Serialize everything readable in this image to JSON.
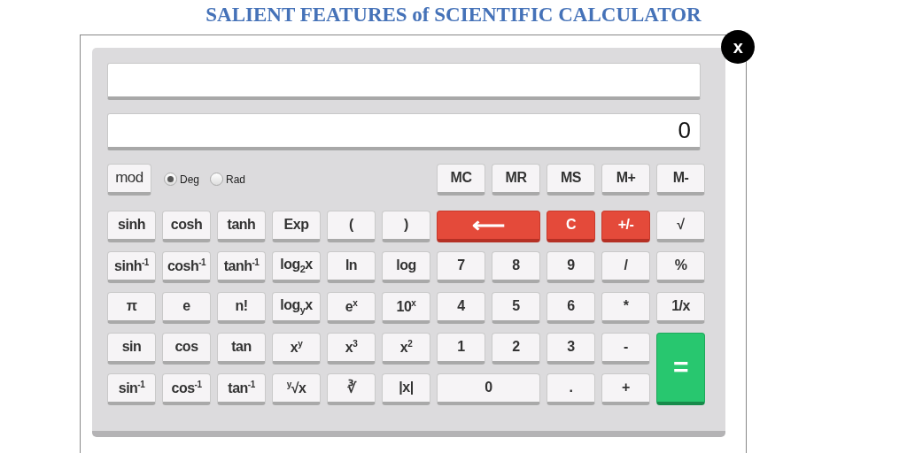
{
  "page_title": "SALIENT FEATURES of SCIENTIFIC CALCULATOR",
  "close_button": "x",
  "displays": [
    {
      "kind": "expression"
    },
    {
      "kind": "result",
      "value": "0"
    }
  ],
  "mode_button": "mod",
  "angle_units": [
    {
      "label": "Deg",
      "selected": true
    },
    {
      "label": "Rad",
      "selected": false
    }
  ],
  "memory_keys": [
    "MC",
    "MR",
    "MS",
    "M+",
    "M-"
  ],
  "keys": [
    {
      "label": "sinh",
      "kind": "plain"
    },
    {
      "label": "cosh",
      "kind": "plain"
    },
    {
      "label": "tanh",
      "kind": "plain"
    },
    {
      "label": "Exp",
      "kind": "plain"
    },
    {
      "label": "(",
      "kind": "plain"
    },
    {
      "label": ")",
      "kind": "plain"
    },
    {
      "label": "⟵",
      "kind": "red-wide"
    },
    {
      "label": "C",
      "kind": "red"
    },
    {
      "label": "+/-",
      "kind": "red"
    },
    {
      "label": "√",
      "kind": "plain"
    },
    {
      "label": "sinh$^{-1}$",
      "kind": "plain"
    },
    {
      "label": "cosh$^{-1}$",
      "kind": "plain"
    },
    {
      "label": "tanh$^{-1}$",
      "kind": "plain"
    },
    {
      "label": "log$_{2}$x",
      "kind": "plain"
    },
    {
      "label": "ln",
      "kind": "plain"
    },
    {
      "label": "log",
      "kind": "plain"
    },
    {
      "label": "7",
      "kind": "plain"
    },
    {
      "label": "8",
      "kind": "plain"
    },
    {
      "label": "9",
      "kind": "plain"
    },
    {
      "label": "/",
      "kind": "plain"
    },
    {
      "label": "%",
      "kind": "plain"
    },
    {
      "label": "π",
      "kind": "plain"
    },
    {
      "label": "e",
      "kind": "plain"
    },
    {
      "label": "n!",
      "kind": "plain"
    },
    {
      "label": "log$_{y}$x",
      "kind": "plain"
    },
    {
      "label": "e$^{x}$",
      "kind": "plain"
    },
    {
      "label": "10$^{x}$",
      "kind": "plain"
    },
    {
      "label": "4",
      "kind": "plain"
    },
    {
      "label": "5",
      "kind": "plain"
    },
    {
      "label": "6",
      "kind": "plain"
    },
    {
      "label": "*",
      "kind": "plain"
    },
    {
      "label": "1/x",
      "kind": "plain"
    },
    {
      "label": "sin",
      "kind": "plain"
    },
    {
      "label": "cos",
      "kind": "plain"
    },
    {
      "label": "tan",
      "kind": "plain"
    },
    {
      "label": "x$^{y}$",
      "kind": "plain"
    },
    {
      "label": "x$^{3}$",
      "kind": "plain"
    },
    {
      "label": "x$^{2}$",
      "kind": "plain"
    },
    {
      "label": "1",
      "kind": "plain"
    },
    {
      "label": "2",
      "kind": "plain"
    },
    {
      "label": "3",
      "kind": "plain"
    },
    {
      "label": "-",
      "kind": "plain"
    },
    {
      "label": "=",
      "kind": "green-tall"
    },
    {
      "label": "sin$^{-1}$",
      "kind": "plain"
    },
    {
      "label": "cos$^{-1}$",
      "kind": "plain"
    },
    {
      "label": "tan$^{-1}$",
      "kind": "plain"
    },
    {
      "label": "$^{y}$√x",
      "kind": "plain"
    },
    {
      "label": "∛",
      "kind": "plain"
    },
    {
      "label": "|x|",
      "kind": "plain"
    },
    {
      "label": "0",
      "kind": "plain-wide"
    },
    {
      "label": ".",
      "kind": "plain"
    },
    {
      "label": "+",
      "kind": "plain"
    }
  ]
}
